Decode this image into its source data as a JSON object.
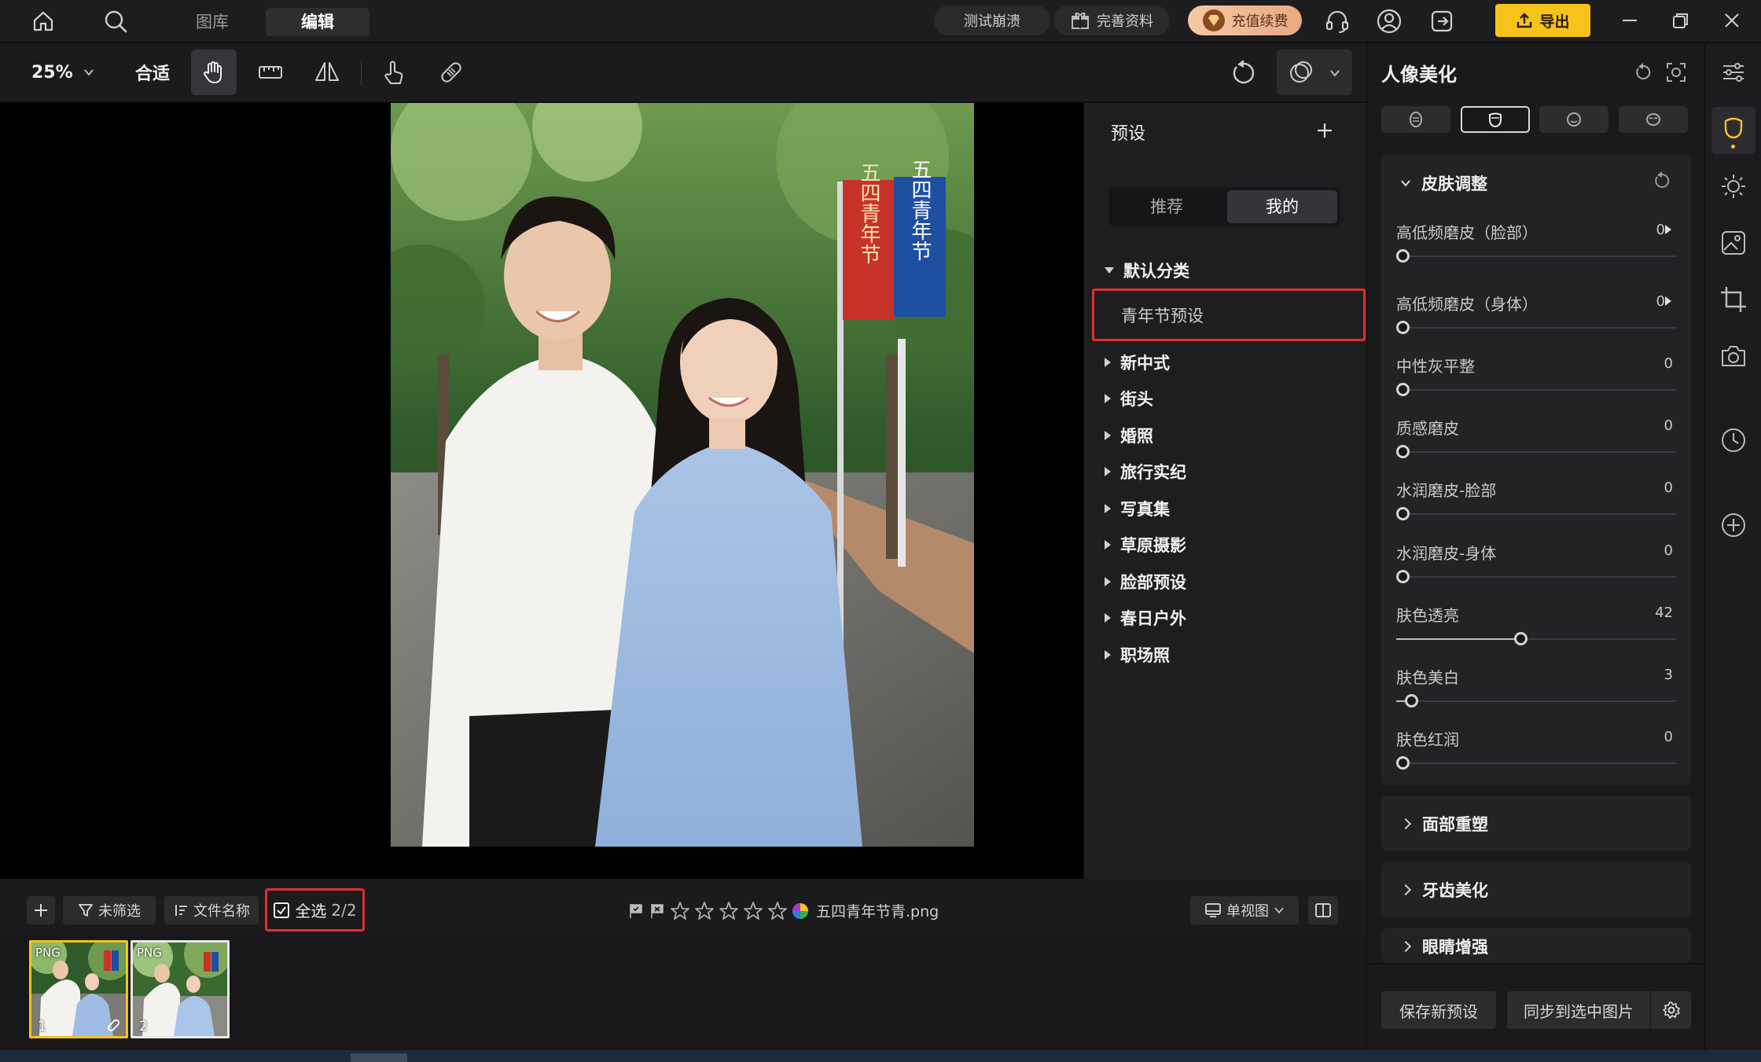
{
  "topbar": {
    "nav_tabs": [
      "图库",
      "编辑"
    ],
    "active_tab": "编辑",
    "test_crash": "测试崩溃",
    "complete_profile": "完善资料",
    "recharge": "充值续费",
    "export": "导出"
  },
  "toolbar": {
    "zoom": "25%",
    "fit": "合适"
  },
  "presets": {
    "title": "预设",
    "tabs": [
      "推荐",
      "我的"
    ],
    "active_tab": "我的",
    "default_category": "默认分类",
    "default_items": [
      "青年节预设"
    ],
    "categories": [
      "新中式",
      "街头",
      "婚照",
      "旅行实纪",
      "写真集",
      "草原摄影",
      "脸部预设",
      "春日户外",
      "职场照"
    ]
  },
  "panel": {
    "title": "人像美化",
    "section": "皮肤调整",
    "sliders": [
      {
        "name": "高低频磨皮（脸部）",
        "value": 0,
        "max": 100,
        "has_arrow": true
      },
      {
        "name": "高低频磨皮（身体）",
        "value": 0,
        "max": 100,
        "has_arrow": true
      },
      {
        "name": "中性灰平整",
        "value": 0,
        "max": 100
      },
      {
        "name": "质感磨皮",
        "value": 0,
        "max": 100
      },
      {
        "name": "水润磨皮-脸部",
        "value": 0,
        "max": 100
      },
      {
        "name": "水润磨皮-身体",
        "value": 0,
        "max": 100
      },
      {
        "name": "肤色透亮",
        "value": 42,
        "max": 100
      },
      {
        "name": "肤色美白",
        "value": 3,
        "max": 100
      },
      {
        "name": "肤色红润",
        "value": 0,
        "max": 100
      }
    ],
    "collapsed_sections": [
      "面部重塑",
      "牙齿美化",
      "眼睛增强"
    ],
    "save_preset": "保存新预设",
    "sync_selected": "同步到选中图片"
  },
  "filmstrip": {
    "filter": "未筛选",
    "sort": "文件名称",
    "select_all": "全选",
    "select_count": "2/2",
    "filename": "五四青年节青.png",
    "view_mode": "单视图",
    "thumbnails": [
      {
        "badge": "PNG",
        "index": "1",
        "selected": true
      },
      {
        "badge": "PNG",
        "index": "2",
        "selected": false
      }
    ]
  },
  "photo": {
    "banner_left": "五四青年节",
    "banner_right": "五四青年节"
  },
  "colors": {
    "accent_yellow": "#f7c31a",
    "highlight_red": "#e0302d",
    "panel_bg": "#1a1a1c"
  }
}
